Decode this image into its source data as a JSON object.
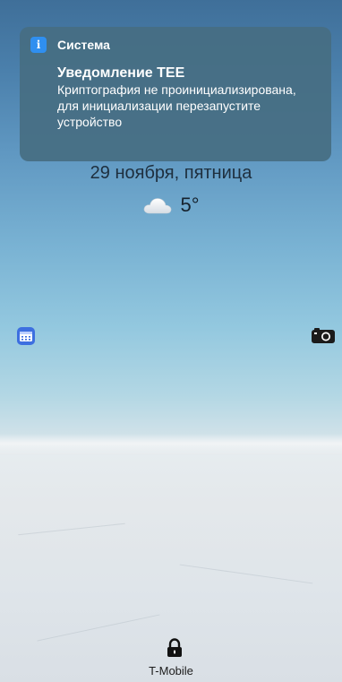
{
  "notification": {
    "app_name": "Система",
    "info_icon_glyph": "i",
    "title": "Уведомление TEE",
    "body": "Криптография не проинициализирована, для инициализации перезапустите устройство"
  },
  "lockscreen": {
    "date": "29 ноября, пятница",
    "weather": {
      "icon": "cloud-icon",
      "temperature": "5°"
    },
    "shortcuts": {
      "left": "calendar-icon",
      "right": "camera-icon"
    },
    "lock_icon": "lock-icon",
    "carrier": "T-Mobile"
  },
  "colors": {
    "notification_bg": "#466e82",
    "info_icon_bg": "#2f8ff0",
    "calendar_icon": "#3d6fe0"
  }
}
